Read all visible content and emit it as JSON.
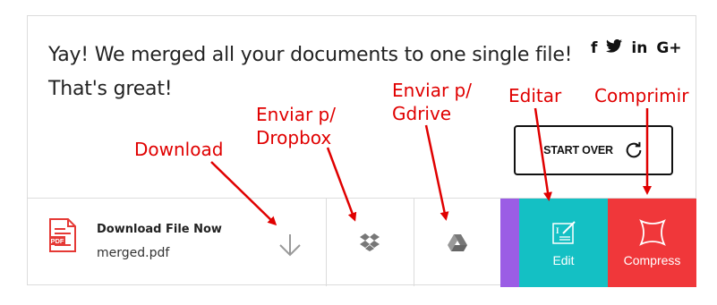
{
  "message": {
    "line1": "Yay! We merged all your documents to one single file!",
    "line2": "That's great!"
  },
  "social": [
    "f",
    "🐦",
    "in",
    "G+"
  ],
  "social_icons": [
    "facebook-icon",
    "twitter-icon",
    "linkedin-icon",
    "google-plus-icon"
  ],
  "start_over": {
    "label": "START OVER"
  },
  "download": {
    "title": "Download File Now",
    "filename": "merged.pdf",
    "badge": "PDF"
  },
  "edit": {
    "label": "Edit"
  },
  "compress": {
    "label": "Compress"
  },
  "annotations": {
    "download": "Download",
    "dropbox_line1": "Enviar p/",
    "dropbox_line2": "Dropbox",
    "gdrive_line1": "Enviar p/",
    "gdrive_line2": "Gdrive",
    "edit": "Editar",
    "compress": "Comprimir"
  },
  "colors": {
    "pdf_red": "#e53935",
    "purple": "#9b5de5",
    "teal": "#14c0c4",
    "red": "#f0373a",
    "annotation": "#e00000"
  }
}
